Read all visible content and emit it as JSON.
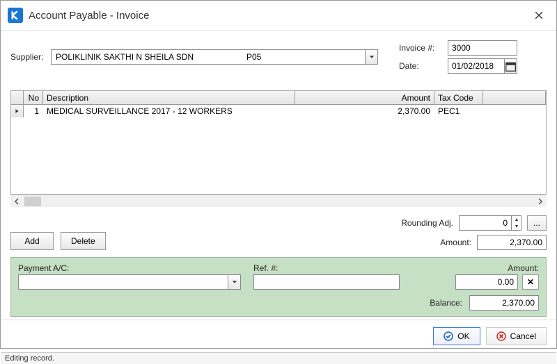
{
  "window": {
    "title": "Account Payable - Invoice"
  },
  "supplier": {
    "label": "Supplier:",
    "name": "POLIKLINIK SAKTHI N SHEILA SDN",
    "code": "P05"
  },
  "invoice": {
    "number_label": "Invoice #:",
    "number": "3000",
    "date_label": "Date:",
    "date": "01/02/2018"
  },
  "grid": {
    "headers": {
      "no": "No",
      "desc": "Description",
      "amount": "Amount",
      "tax": "Tax Code"
    },
    "rows": [
      {
        "no": "1",
        "desc": "MEDICAL SURVEILLANCE 2017 - 12 WORKERS",
        "amount": "2,370.00",
        "tax": "PEC1"
      }
    ]
  },
  "buttons": {
    "add": "Add",
    "delete": "Delete",
    "ok": "OK",
    "cancel": "Cancel"
  },
  "totals": {
    "rounding_label": "Rounding Adj.",
    "rounding_value": "0",
    "amount_label": "Amount:",
    "amount_value": "2,370.00"
  },
  "payment": {
    "ac_label": "Payment A/C:",
    "ac_value": "",
    "ref_label": "Ref. #:",
    "ref_value": "",
    "amount_label": "Amount:",
    "amount_value": "0.00",
    "balance_label": "Balance:",
    "balance_value": "2,370.00"
  },
  "status": "Editing record."
}
